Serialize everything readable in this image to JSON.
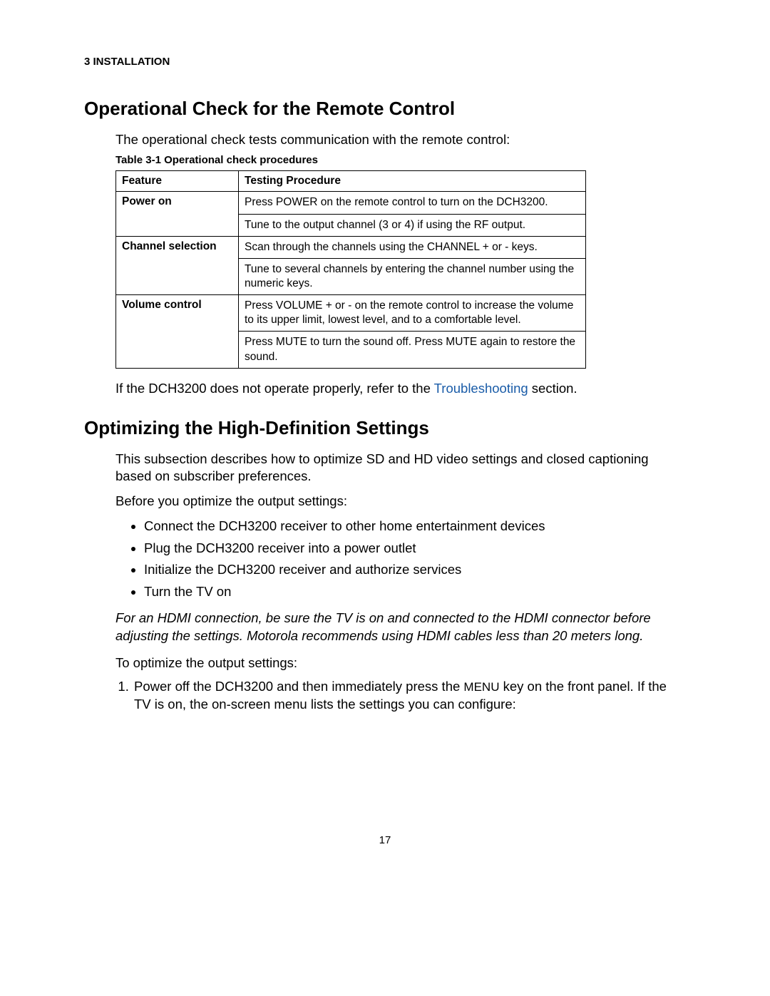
{
  "header": {
    "section_label": "3 INSTALLATION"
  },
  "section1": {
    "heading": "Operational Check for the Remote Control",
    "intro": "The operational check tests communication with the remote control:",
    "table_caption": "Table 3-1 Operational check procedures",
    "table": {
      "head_feature": "Feature",
      "head_procedure": "Testing Procedure",
      "rows": [
        {
          "feature": "Power on",
          "cells": [
            "Press POWER on the remote control to turn on the DCH3200.",
            "Tune to the output channel (3 or 4) if using the RF output."
          ]
        },
        {
          "feature": "Channel selection",
          "cells": [
            "Scan through the channels using the CHANNEL + or - keys.",
            "Tune to several channels by entering the channel number using the numeric keys."
          ]
        },
        {
          "feature": "Volume control",
          "cells": [
            "Press VOLUME + or - on the remote control to increase the volume to its upper limit, lowest level, and to a comfortable level.",
            "Press MUTE to turn the sound off. Press MUTE again to restore the sound."
          ]
        }
      ]
    },
    "after_table_pre": "If the DCH3200 does not operate properly, refer to the ",
    "after_table_link": "Troubleshooting",
    "after_table_post": " section."
  },
  "section2": {
    "heading": "Optimizing the High-Definition Settings",
    "intro": "This subsection describes how to optimize SD and HD video settings and closed captioning based on subscriber preferences.",
    "before": "Before you optimize the output settings:",
    "bullets": [
      "Connect the DCH3200 receiver to other home entertainment devices",
      "Plug the DCH3200 receiver into a power outlet",
      "Initialize the DCH3200 receiver and authorize services",
      "Turn the TV on"
    ],
    "note": "For an HDMI connection, be sure the TV is on and connected to the HDMI connector before adjusting the settings. Motorola recommends using HDMI cables less than 20 meters long.",
    "to_optimize": "To optimize the output settings:",
    "step1_pre": "Power off the DCH3200 and then immediately press the ",
    "step1_menu": "MENU",
    "step1_post": " key on the front panel. If the TV is on, the on-screen menu lists the settings you can configure:"
  },
  "page_number": "17"
}
